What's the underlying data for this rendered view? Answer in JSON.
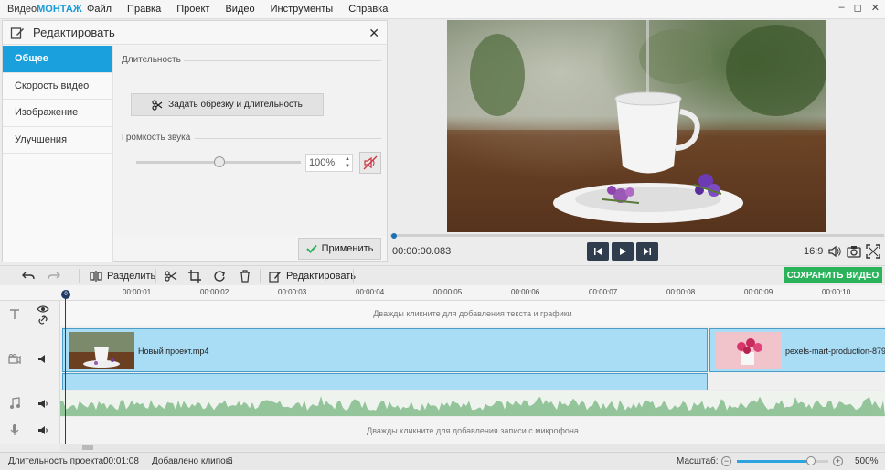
{
  "app": {
    "logo_part1": "Видео",
    "logo_part2": "МОНТАЖ"
  },
  "menu": [
    "Файл",
    "Правка",
    "Проект",
    "Видео",
    "Инструменты",
    "Справка"
  ],
  "window_controls": {
    "minimize": "–",
    "maximize": "◻",
    "close": "✕"
  },
  "edit_panel": {
    "title": "Редактировать",
    "close": "✕",
    "nav": [
      "Общее",
      "Скорость видео",
      "Изображение",
      "Улучшения"
    ],
    "active_nav": "Общее",
    "duration_label": "Длительность",
    "trim_button": "Задать обрезку и длительность",
    "volume_label": "Громкость звука",
    "volume_value": "100%",
    "volume_level": 0.5,
    "apply_button": "Применить"
  },
  "player": {
    "timecode": "00:00:00.083",
    "aspect": "16:9",
    "progress": 0.0
  },
  "toolbar": {
    "split": "Разделить",
    "edit": "Редактировать",
    "save": "СОХРАНИТЬ ВИДЕО"
  },
  "timeline": {
    "playhead_label": "0",
    "ruler": [
      "00:00:01",
      "00:00:02",
      "00:00:03",
      "00:00:04",
      "00:00:05",
      "00:00:06",
      "00:00:07",
      "00:00:08",
      "00:00:09",
      "00:00:10"
    ],
    "text_track_hint": "Дважды кликните для добавления текста и графики",
    "mic_track_hint": "Дважды кликните для добавления записи с микрофона",
    "clips": [
      {
        "name": "Новый проект.mp4"
      },
      {
        "name": "pexels-mart-production-879"
      }
    ]
  },
  "status": {
    "duration_label": "Длительность проекта:",
    "duration_value": "00:01:08",
    "clips_label": "Добавлено клипов:",
    "clips_value": "5",
    "scale_label": "Масштаб:",
    "scale_value": "500%",
    "zoom_minus": "−",
    "zoom_plus": "+"
  },
  "colors": {
    "accent": "#1aa0dc",
    "save": "#2bb35b",
    "clip": "#a9dcf5",
    "audio_wave": "#93c49a"
  }
}
